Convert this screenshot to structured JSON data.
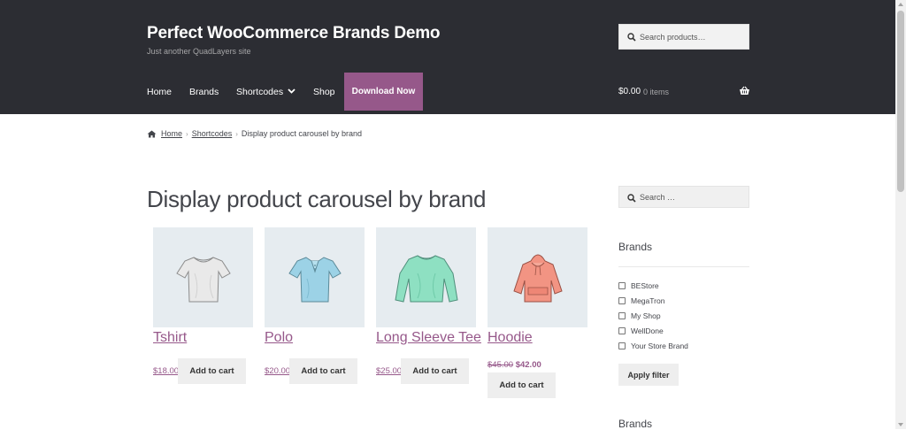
{
  "site": {
    "title": "Perfect WooCommerce Brands Demo",
    "tagline": "Just another QuadLayers site"
  },
  "header_search": {
    "placeholder": "Search products…",
    "icon": "search-icon"
  },
  "nav": {
    "items": [
      {
        "label": "Home"
      },
      {
        "label": "Brands"
      },
      {
        "label": "Shortcodes",
        "has_dropdown": true
      },
      {
        "label": "Shop"
      }
    ],
    "cta_label": "Download Now",
    "cta_color": "#96588a"
  },
  "cart": {
    "amount": "$0.00",
    "count": "0 items",
    "icon": "basket-icon"
  },
  "breadcrumb": {
    "icon": "home-icon",
    "items": [
      "Home",
      "Shortcodes",
      "Display product carousel by brand"
    ]
  },
  "page": {
    "title": "Display product carousel by brand"
  },
  "products": [
    {
      "name": "Tshirt",
      "price": "$18.00",
      "button": "Add to cart",
      "image": "tshirt-image"
    },
    {
      "name": "Polo",
      "price": "$20.00",
      "button": "Add to cart",
      "image": "polo-image"
    },
    {
      "name": "Long Sleeve Tee",
      "price": "$25.00",
      "button": "Add to cart",
      "image": "long-sleeve-tee-image"
    },
    {
      "name": "Hoodie",
      "price_old": "$45.00",
      "price_new": "$42.00",
      "button": "Add to cart",
      "image": "hoodie-image"
    }
  ],
  "sidebar": {
    "search_placeholder": "Search …",
    "brands_title": "Brands",
    "brands": [
      "BEStore",
      "MegaTron",
      "My Shop",
      "WellDone",
      "Your Store Brand"
    ],
    "apply_label": "Apply filter",
    "second_title": "Brands"
  },
  "colors": {
    "header_bg": "#2c2d33",
    "accent": "#96588a",
    "text": "#43454b",
    "product_bg": "#e6ecf0"
  }
}
